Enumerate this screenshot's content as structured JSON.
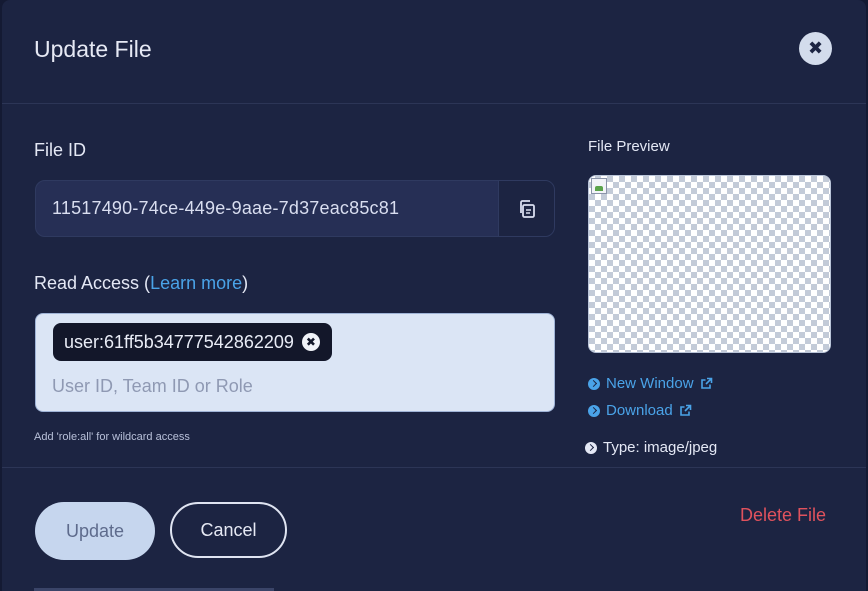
{
  "modal": {
    "title": "Update File",
    "close_icon": "close-icon"
  },
  "file_id": {
    "label": "File ID",
    "value": "11517490-74ce-449e-9aae-7d37eac85c81",
    "copy_icon": "copy-icon"
  },
  "read_access": {
    "label_prefix": "Read Access (",
    "learn_more": "Learn more",
    "label_suffix": ")",
    "chips": [
      "user:61ff5b34777542862209"
    ],
    "placeholder": "User ID, Team ID or Role",
    "hint": "Add 'role:all' for wildcard access"
  },
  "preview": {
    "label": "File Preview",
    "new_window": "New Window",
    "download": "Download",
    "type": "Type: image/jpeg"
  },
  "footer": {
    "update": "Update",
    "cancel": "Cancel",
    "delete": "Delete File"
  },
  "colors": {
    "background": "#1c2442",
    "link": "#4aa3e8",
    "danger": "#e0525d",
    "field": "#262f55"
  }
}
